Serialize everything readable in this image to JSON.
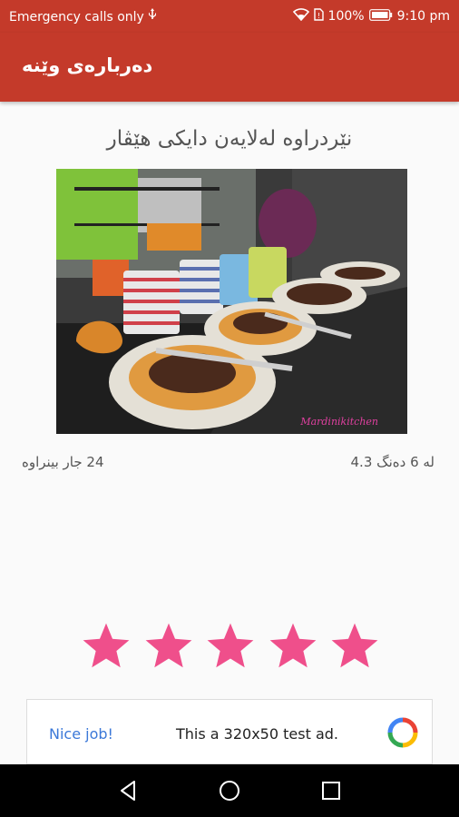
{
  "status_bar": {
    "left_text": "Emergency calls only",
    "battery": "100%",
    "time": "9:10 pm"
  },
  "app_bar": {
    "title": "دەربارەی وێنە"
  },
  "photo": {
    "caption": "نێردراوە لەلایەن دایکی هێڤار",
    "watermark": "Mardinikitchen"
  },
  "stats": {
    "views": "24 جار بینراوە",
    "rating": "لە 6 دەنگ 4.3"
  },
  "rating_stars": {
    "filled": 5,
    "total": 5,
    "color": "#ef4f8b"
  },
  "ad": {
    "label": "Nice job!",
    "text": "This a 320x50 test ad."
  },
  "nav": {
    "back": "back-icon",
    "home": "home-icon",
    "recents": "recents-icon"
  },
  "colors": {
    "primary": "#c43a2a",
    "star": "#ef4f8b",
    "ad_link": "#3b78d8"
  }
}
